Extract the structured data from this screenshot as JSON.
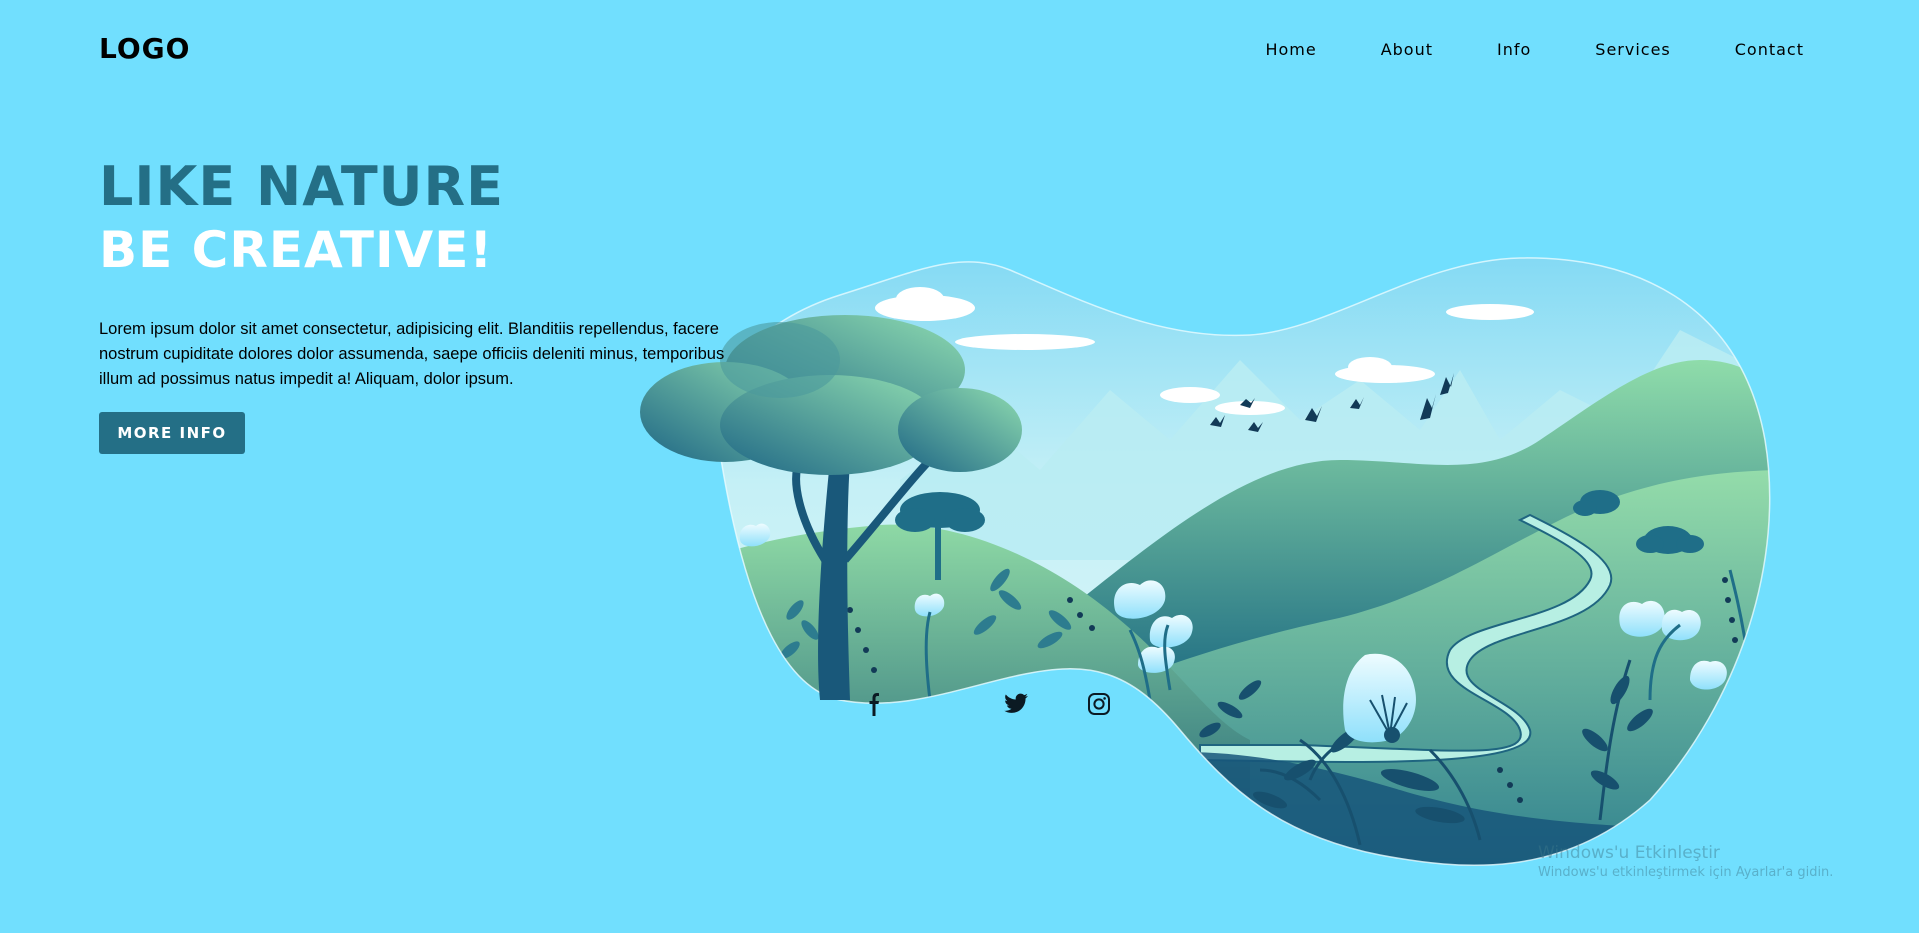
{
  "brand": {
    "logo_text": "LOGO"
  },
  "nav": {
    "items": [
      {
        "label": "Home"
      },
      {
        "label": "About"
      },
      {
        "label": "Info"
      },
      {
        "label": "Services"
      },
      {
        "label": "Contact"
      }
    ]
  },
  "hero": {
    "title_line1": "LIKE NATURE",
    "title_line2": "BE CREATIVE!",
    "body": "Lorem ipsum dolor sit amet consectetur, adipisicing elit. Blanditiis repellendus, facere nostrum cupiditate dolores dolor assumenda, saepe officiis deleniti minus, temporibus illum ad possimus natus impedit a! Aliquam, dolor ipsum.",
    "button_label": "MORE INFO"
  },
  "social": [
    {
      "icon": "facebook-icon"
    },
    {
      "icon": "twitter-icon"
    },
    {
      "icon": "instagram-icon"
    }
  ],
  "watermark": {
    "title": "Windows'u Etkinleştir",
    "subtitle": "Windows'u etkinleştirmek için Ayarlar'a gidin."
  },
  "colors": {
    "background": "#71dffe",
    "accent": "#246f86",
    "title_white": "#ffffff",
    "text_dark": "#000000"
  }
}
